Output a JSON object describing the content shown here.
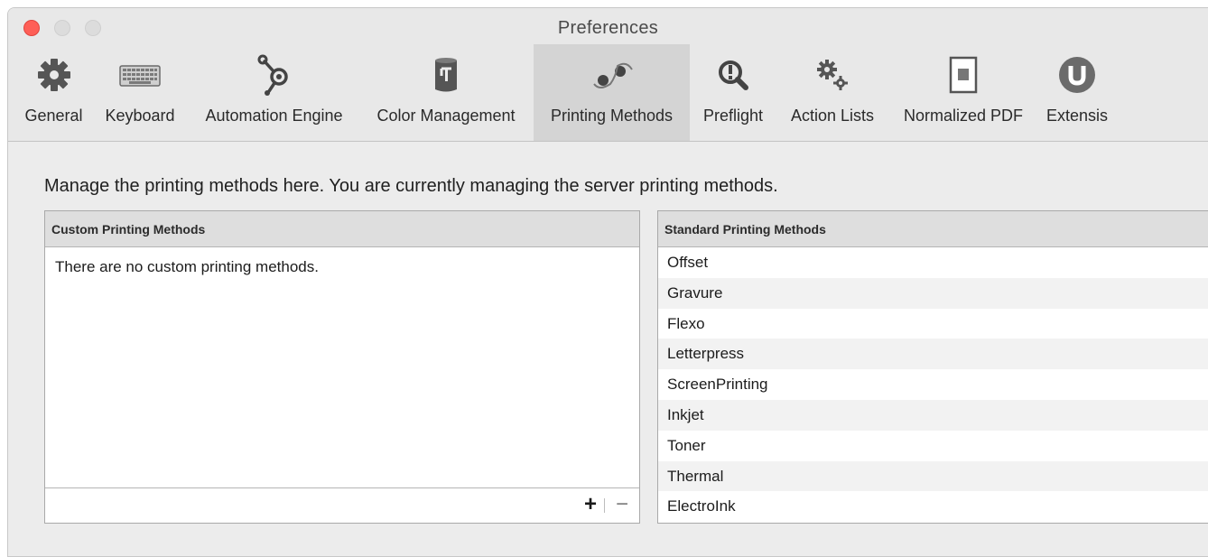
{
  "window": {
    "title": "Preferences"
  },
  "toolbar": {
    "items": [
      {
        "label": "General",
        "icon": "gear-icon"
      },
      {
        "label": "Keyboard",
        "icon": "keyboard-icon"
      },
      {
        "label": "Automation Engine",
        "icon": "automation-engine-icon"
      },
      {
        "label": "Color Management",
        "icon": "color-management-icon"
      },
      {
        "label": "Printing Methods",
        "icon": "printing-methods-icon",
        "selected": true
      },
      {
        "label": "Preflight",
        "icon": "preflight-magnifier-icon"
      },
      {
        "label": "Action Lists",
        "icon": "action-lists-gears-icon"
      },
      {
        "label": "Normalized PDF",
        "icon": "normalized-pdf-icon"
      },
      {
        "label": "Extensis",
        "icon": "extensis-logo-icon"
      }
    ]
  },
  "main": {
    "description": "Manage the printing methods here. You are currently managing the server printing methods.",
    "custom": {
      "header": "Custom Printing Methods",
      "empty_text": "There are no custom printing methods.",
      "add_label": "+",
      "remove_label": "−"
    },
    "standard": {
      "header": "Standard Printing Methods",
      "items": [
        "Offset",
        "Gravure",
        "Flexo",
        "Letterpress",
        "ScreenPrinting",
        "Inkjet",
        "Toner",
        "Thermal",
        "ElectroInk"
      ]
    }
  },
  "colors": {
    "close": "#fe5f57",
    "selected_tab": "#d4d4d4",
    "extensis_brand": "#6b6b6b"
  }
}
